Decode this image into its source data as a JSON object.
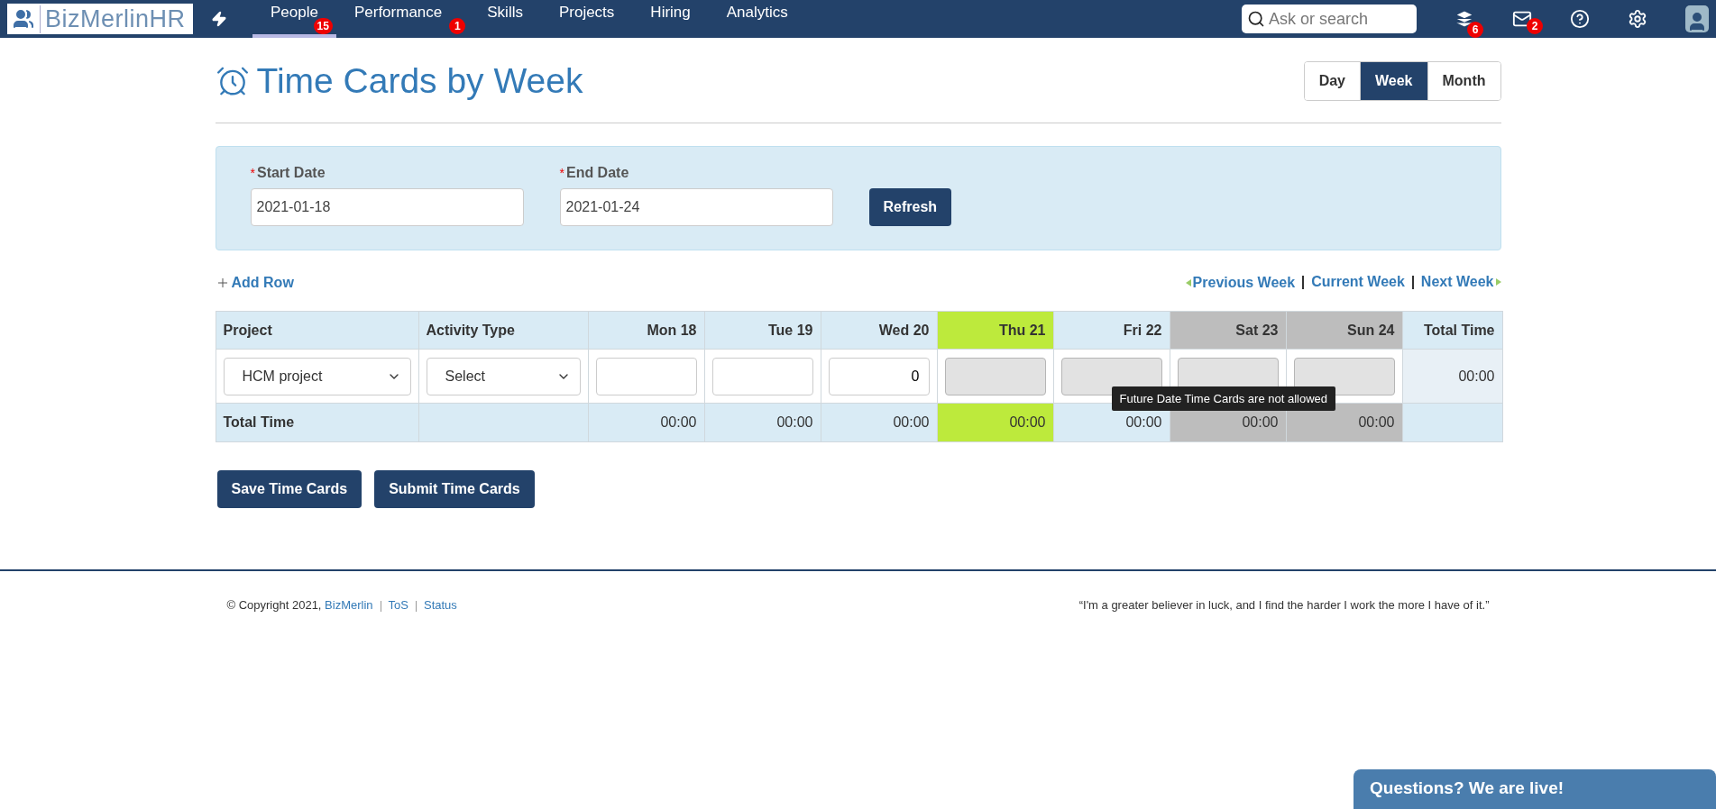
{
  "brand": {
    "name": "BizMerlinHR"
  },
  "nav": {
    "items": [
      {
        "label": "People",
        "selected": true,
        "badge": "15"
      },
      {
        "label": "Performance",
        "selected": false,
        "badge": "1"
      },
      {
        "label": "Skills",
        "selected": false
      },
      {
        "label": "Projects",
        "selected": false
      },
      {
        "label": "Hiring",
        "selected": false
      },
      {
        "label": "Analytics",
        "selected": false
      }
    ],
    "search": {
      "placeholder": "Ask or search"
    },
    "layers_badge": "6",
    "mail_badge": "2"
  },
  "page": {
    "title": "Time Cards by Week",
    "views": [
      {
        "label": "Day",
        "selected": false
      },
      {
        "label": "Week",
        "selected": true
      },
      {
        "label": "Month",
        "selected": false
      }
    ]
  },
  "filters": {
    "fields": [
      {
        "label": "Start Date",
        "required_mark": "*",
        "value": "2021-01-18"
      },
      {
        "label": "End Date",
        "required_mark": "*",
        "value": "2021-01-24"
      }
    ],
    "refresh": "Refresh"
  },
  "toolbar": {
    "add_row": "Add Row",
    "previous": "Previous Week",
    "current": "Current Week",
    "next": "Next Week"
  },
  "table": {
    "project_header": "Project",
    "activity_header": "Activity Type",
    "total_header": "Total Time",
    "days": [
      {
        "label": "Mon 18",
        "kind": "weekday",
        "disabled": false,
        "total": "00:00"
      },
      {
        "label": "Tue 19",
        "kind": "weekday",
        "disabled": false,
        "total": "00:00"
      },
      {
        "label": "Wed 20",
        "kind": "weekday",
        "disabled": false,
        "value": "0",
        "total": "00:00"
      },
      {
        "label": "Thu 21",
        "kind": "today",
        "disabled": true,
        "total": "00:00"
      },
      {
        "label": "Fri 22",
        "kind": "weekday",
        "disabled": true,
        "total": "00:00"
      },
      {
        "label": "Sat 23",
        "kind": "weekend",
        "disabled": true,
        "total": "00:00"
      },
      {
        "label": "Sun 24",
        "kind": "weekend",
        "disabled": true,
        "total": "00:00"
      }
    ],
    "row": {
      "project": "HCM project",
      "activity": "Select",
      "total": "00:00"
    },
    "total_label": "Total Time",
    "tooltip": "Future Date Time Cards are not allowed"
  },
  "actions": [
    "Save Time Cards",
    "Submit Time Cards"
  ],
  "footer": {
    "copyright": "© Copyright 2021,",
    "links": [
      "BizMerlin",
      "ToS",
      "Status"
    ],
    "quote": "“I'm a greater believer in luck, and I find the harder I work the more I have of it.”"
  },
  "chat": {
    "label": "Questions? We are live!"
  }
}
